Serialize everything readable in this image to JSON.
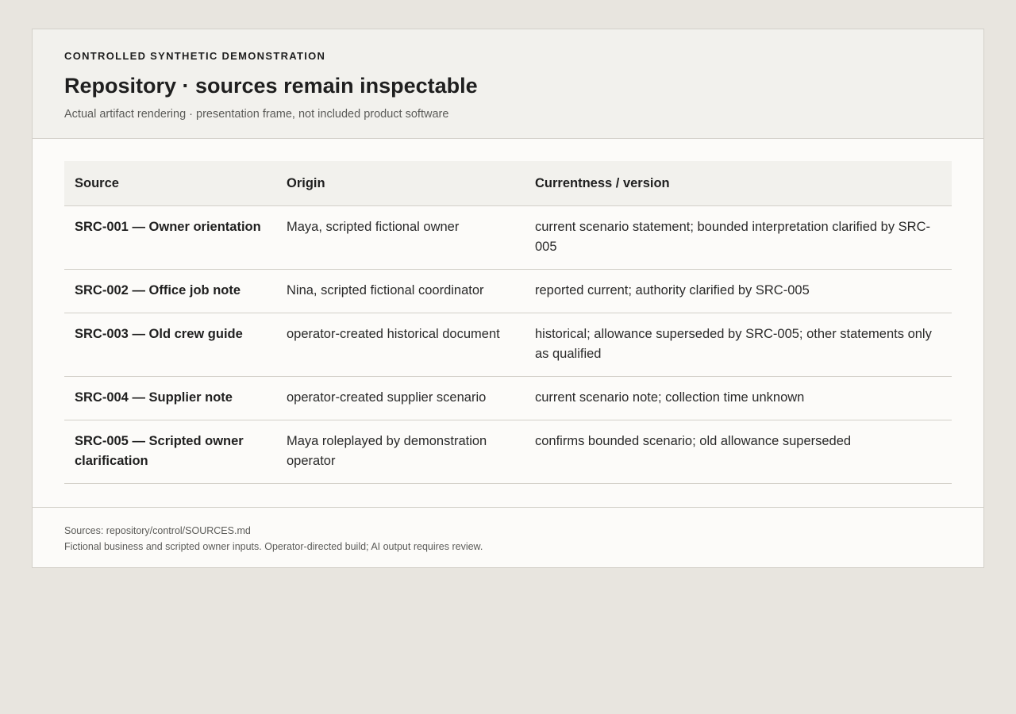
{
  "header": {
    "eyebrow": "CONTROLLED SYNTHETIC DEMONSTRATION",
    "title": "Repository · sources remain inspectable",
    "subtitle": "Actual artifact rendering · presentation frame, not included product software"
  },
  "table": {
    "columns": [
      "Source",
      "Origin",
      "Currentness / version"
    ],
    "rows": [
      {
        "source": "SRC-001 — Owner orientation",
        "origin": "Maya, scripted fictional owner",
        "currentness": "current scenario statement; bounded interpretation clarified by SRC-005"
      },
      {
        "source": "SRC-002 — Office job note",
        "origin": "Nina, scripted fictional coordinator",
        "currentness": "reported current; authority clarified by SRC-005"
      },
      {
        "source": "SRC-003 — Old crew guide",
        "origin": "operator-created historical document",
        "currentness": "historical; allowance superseded by SRC-005; other statements only as qualified"
      },
      {
        "source": "SRC-004 — Supplier note",
        "origin": "operator-created supplier scenario",
        "currentness": "current scenario note; collection time unknown"
      },
      {
        "source": "SRC-005 — Scripted owner clarification",
        "origin": "Maya roleplayed by demonstration operator",
        "currentness": "confirms bounded scenario; old allowance superseded"
      }
    ]
  },
  "footer": {
    "sources_line": "Sources: repository/control/SOURCES.md",
    "disclaimer": "Fictional business and scripted owner inputs. Operator-directed build; AI output requires review."
  }
}
